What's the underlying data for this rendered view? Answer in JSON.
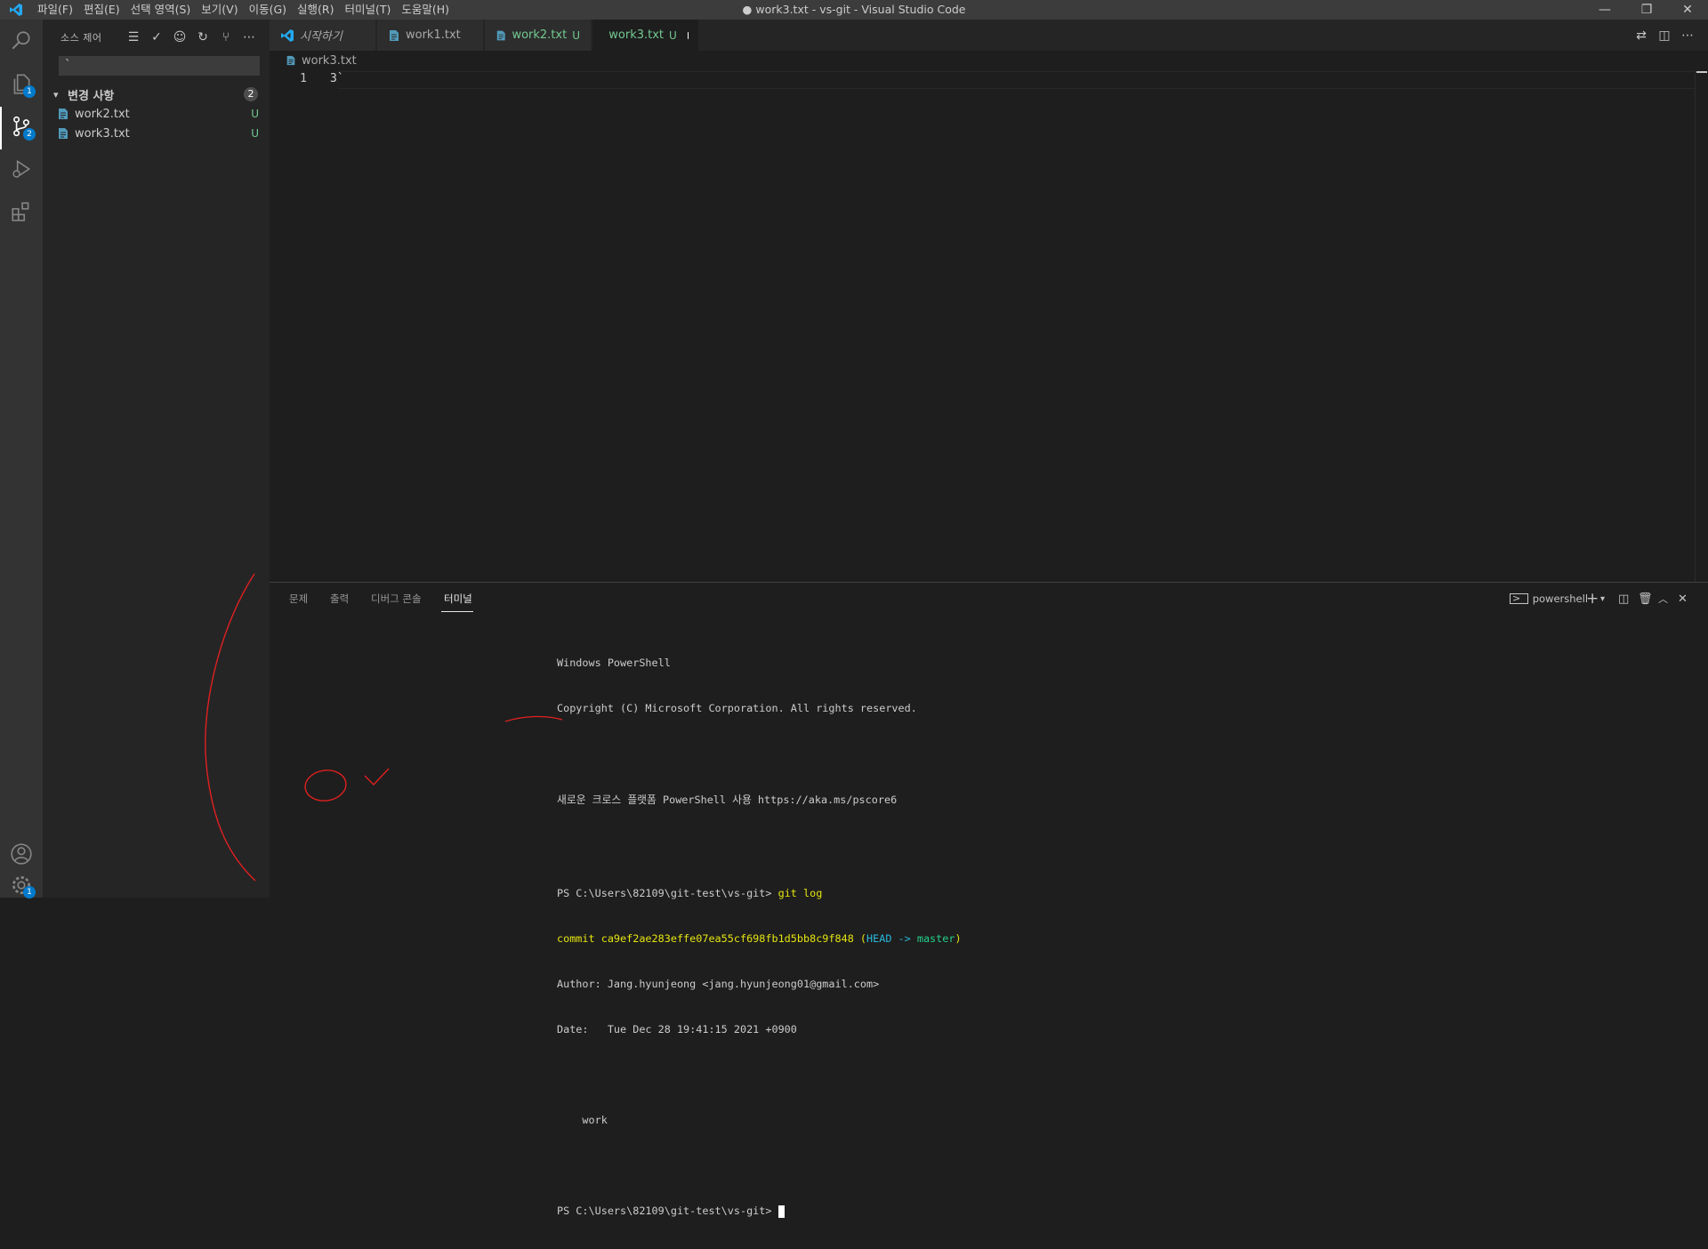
{
  "window": {
    "title": "● work3.txt - vs-git - Visual Studio Code",
    "controls": [
      "—",
      "❐",
      "✕"
    ]
  },
  "menu": [
    "파일(F)",
    "편집(E)",
    "선택 영역(S)",
    "보기(V)",
    "이동(G)",
    "실행(R)",
    "터미널(T)",
    "도움말(H)"
  ],
  "activity_bar": {
    "explorer_badge": "1",
    "scm_badge": "2",
    "manage_badge": "1"
  },
  "sidebar": {
    "title": "소스 제어",
    "commit_message": "`",
    "changes_label": "변경 사항",
    "changes_count": "2",
    "files": [
      {
        "name": "work2.txt",
        "status": "U"
      },
      {
        "name": "work3.txt",
        "status": "U"
      }
    ]
  },
  "tabs": [
    {
      "label": "시작하기",
      "status": "",
      "color": "#a9a9a9"
    },
    {
      "label": "work1.txt",
      "status": "",
      "color": "#a9a9a9"
    },
    {
      "label": "work2.txt",
      "status": "U",
      "color": "#73c991"
    },
    {
      "label": "work3.txt",
      "status": "U",
      "color": "#73c991"
    }
  ],
  "editor": {
    "breadcrumb": "work3.txt",
    "line_number": "1",
    "line_text": "3`"
  },
  "panel": {
    "tabs": [
      "문제",
      "출력",
      "디버그 콘솔",
      "터미널"
    ],
    "active_tab": "터미널",
    "shell_label": "powershell",
    "terminal": {
      "l1": "Windows PowerShell",
      "l2": "Copyright (C) Microsoft Corporation. All rights reserved.",
      "l3": "새로운 크로스 플랫폼 PowerShell 사용 https://aka.ms/pscore6",
      "prompt": "PS C:\\Users\\82109\\git-test\\vs-git> ",
      "command": "git log",
      "commit_prefix": "commit ca9ef2ae283effe07ea55cf698fb1d5bb8c9f848 (",
      "commit_head": "HEAD -> ",
      "commit_branch": "master",
      "commit_suffix": ")",
      "author": "Author: Jang.hyunjeong <jang.hyunjeong01@gmail.com>",
      "date": "Date:   Tue Dec 28 19:41:15 2021 +0900",
      "message": "    work"
    }
  },
  "colors": {
    "accent": "#007acc",
    "untracked": "#73c991",
    "annotation": "#e02020"
  }
}
